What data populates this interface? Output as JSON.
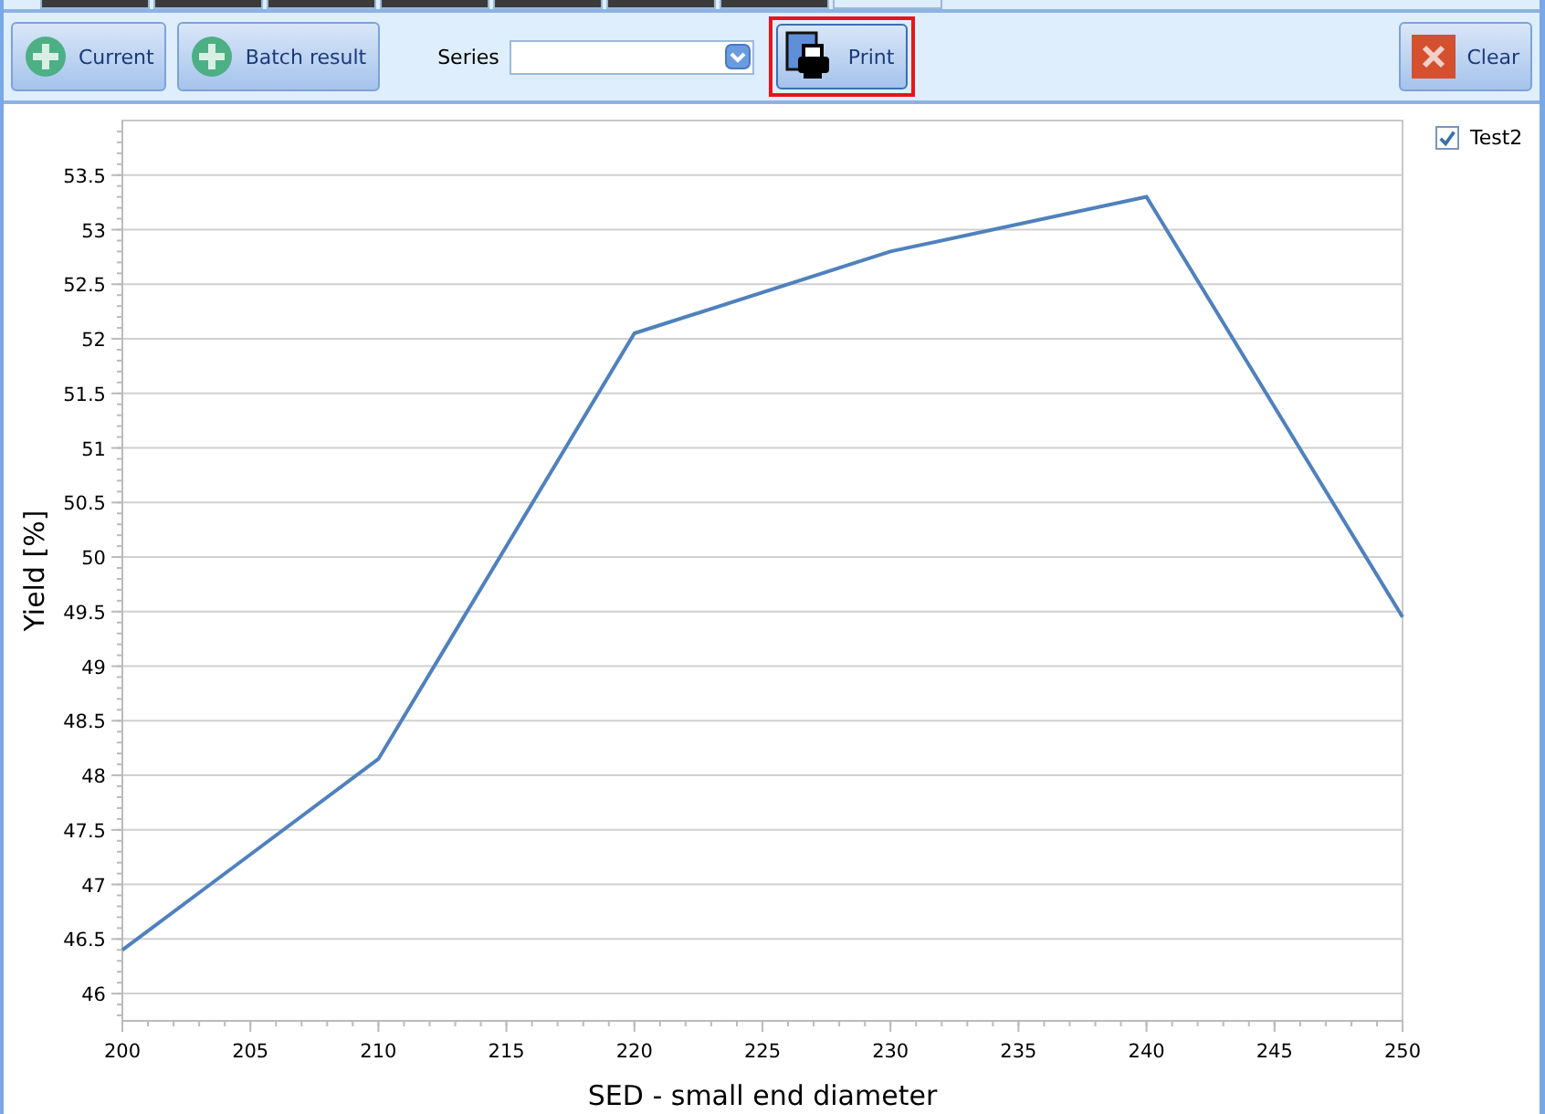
{
  "tabs": [
    {
      "selected": false
    },
    {
      "selected": false
    },
    {
      "selected": false
    },
    {
      "selected": false
    },
    {
      "selected": false
    },
    {
      "selected": false
    },
    {
      "selected": false
    },
    {
      "selected": true
    }
  ],
  "toolbar": {
    "current_button": "Current",
    "batch_button": "Batch result",
    "series_label": "Series",
    "print_button": "Print",
    "clear_button": "Clear"
  },
  "legend": [
    {
      "checked": true
    }
  ],
  "chart_data": {
    "type": "line",
    "xlabel": "SED - small end diameter",
    "ylabel": "Yield [%]",
    "x": [
      200,
      210,
      220,
      230,
      240,
      250
    ],
    "series": [
      {
        "name": "Test2",
        "color": "#4f81bd",
        "values": [
          46.4,
          48.15,
          52.05,
          52.8,
          53.3,
          49.45
        ]
      }
    ],
    "grid": true,
    "xlim": [
      200,
      250
    ],
    "ylim": [
      45.75,
      54
    ],
    "xticks": [
      200,
      205,
      210,
      215,
      220,
      225,
      230,
      235,
      240,
      245,
      250
    ],
    "yticks": [
      46,
      46.5,
      47,
      47.5,
      48,
      48.5,
      49,
      49.5,
      50,
      50.5,
      51,
      51.5,
      52,
      52.5,
      53,
      53.5
    ]
  }
}
